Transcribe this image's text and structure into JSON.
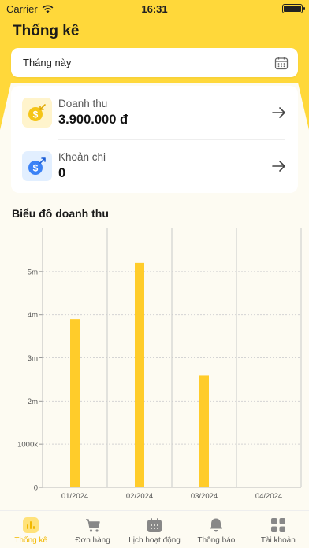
{
  "status_bar": {
    "carrier": "Carrier",
    "time": "16:31"
  },
  "header": {
    "title": "Thống kê"
  },
  "date_filter": {
    "value": "Tháng này",
    "icon": "calendar-icon"
  },
  "summary": {
    "income": {
      "label": "Doanh thu",
      "value": "3.900.000 đ",
      "icon": "income-dollar-icon",
      "accent": "#f5c518"
    },
    "expense": {
      "label": "Khoản chi",
      "value": "0",
      "icon": "expense-dollar-icon",
      "accent": "#3b82f6"
    }
  },
  "chart_title": "Biểu đồ doanh thu",
  "chart_data": {
    "type": "bar",
    "categories": [
      "01/2024",
      "02/2024",
      "03/2024",
      "04/2024"
    ],
    "values": [
      3900000,
      5200000,
      2600000,
      0
    ],
    "y_ticks": [
      0,
      1000000,
      2000000,
      3000000,
      4000000,
      5000000
    ],
    "y_tick_labels": [
      "0",
      "1000k",
      "2m",
      "3m",
      "4m",
      "5m"
    ],
    "ylim": [
      0,
      6000000
    ],
    "bar_color": "#ffcc2a",
    "grid": true
  },
  "tabs": [
    {
      "label": "Thống kê",
      "icon": "stats-icon",
      "active": true
    },
    {
      "label": "Đơn hàng",
      "icon": "cart-icon",
      "active": false
    },
    {
      "label": "Lịch hoạt động",
      "icon": "calendar-icon",
      "active": false
    },
    {
      "label": "Thông báo",
      "icon": "bell-icon",
      "active": false
    },
    {
      "label": "Tài khoản",
      "icon": "grid-icon",
      "active": false
    }
  ]
}
